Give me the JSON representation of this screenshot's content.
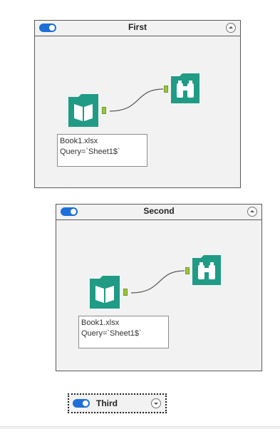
{
  "containers": [
    {
      "title": "First",
      "input_tool": {
        "filename": "Book1.xlsx",
        "query": "Query=`Sheet1$`"
      }
    },
    {
      "title": "Second",
      "input_tool": {
        "filename": "Book1.xlsx",
        "query": "Query=`Sheet1$`"
      }
    },
    {
      "title": "Third"
    }
  ],
  "colors": {
    "toggle": "#1e6fd9",
    "tool_teal": "#1f9b86",
    "anchor": "#9bc53d",
    "container_bg": "#f2f2f2",
    "border": "#5a5a5a"
  },
  "icons": {
    "input_tool": "book-icon",
    "browse_tool": "binoculars-icon",
    "toggle": "toggle-on-icon",
    "collapse": "chevron-up-icon",
    "expand": "chevron-down-icon"
  }
}
